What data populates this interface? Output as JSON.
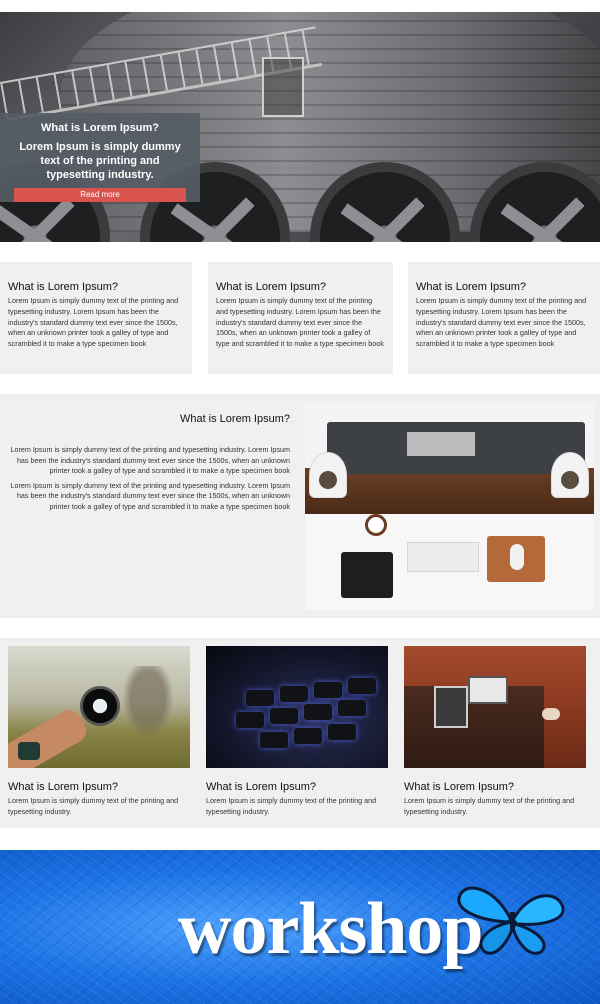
{
  "hero": {
    "title": "What is Lorem Ipsum?",
    "text": "Lorem Ipsum is simply dummy text of the printing and typesetting industry.",
    "button_label": "Read more",
    "button_color": "#d9534f"
  },
  "features": [
    {
      "title": "What is Lorem Ipsum?",
      "text": "Lorem Ipsum is simply dummy text of the printing and typesetting industry. Lorem Ipsum has been the industry's standard dummy text ever since the 1500s, when an unknown printer took a galley of type and scrambled it to make a type specimen book"
    },
    {
      "title": "What is Lorem Ipsum?",
      "text": "Lorem Ipsum is simply dummy text of the printing and typesetting industry. Lorem Ipsum has been the industry's standard dummy text ever since the 1500s, when an unknown printer took a galley of type and scrambled it to make a type specimen book"
    },
    {
      "title": "What is Lorem Ipsum?",
      "text": "Lorem Ipsum is simply dummy text of the printing and typesetting industry. Lorem Ipsum has been the industry's standard dummy text ever since the 1500s, when an unknown printer took a galley of type and scrambled it to make a type specimen book"
    }
  ],
  "about": {
    "title": "What is Lorem Ipsum?",
    "paragraphs": [
      "Lorem Ipsum is simply dummy text of the printing and typesetting industry. Lorem Ipsum has been the industry's standard dummy text ever since the 1500s, when an unknown printer took a galley of type and scrambled it to make a type specimen book",
      "Lorem Ipsum is simply dummy text of the printing and typesetting industry. Lorem Ipsum has been the industry's standard dummy text ever since the 1500s, when an unknown printer took a galley of type and scrambled it to make a type specimen book"
    ]
  },
  "gallery": [
    {
      "title": "What is Lorem Ipsum?",
      "text": "Lorem Ipsum is simply dummy text of the printing and typesetting industry."
    },
    {
      "title": "What is Lorem Ipsum?",
      "text": "Lorem Ipsum is simply dummy text of the printing and typesetting industry."
    },
    {
      "title": "What is Lorem Ipsum?",
      "text": "Lorem Ipsum is simply dummy text of the printing and typesetting industry."
    }
  ],
  "banner": {
    "word": "workshop",
    "icon": "butterfly-icon",
    "background_color": "#1d74e6"
  }
}
